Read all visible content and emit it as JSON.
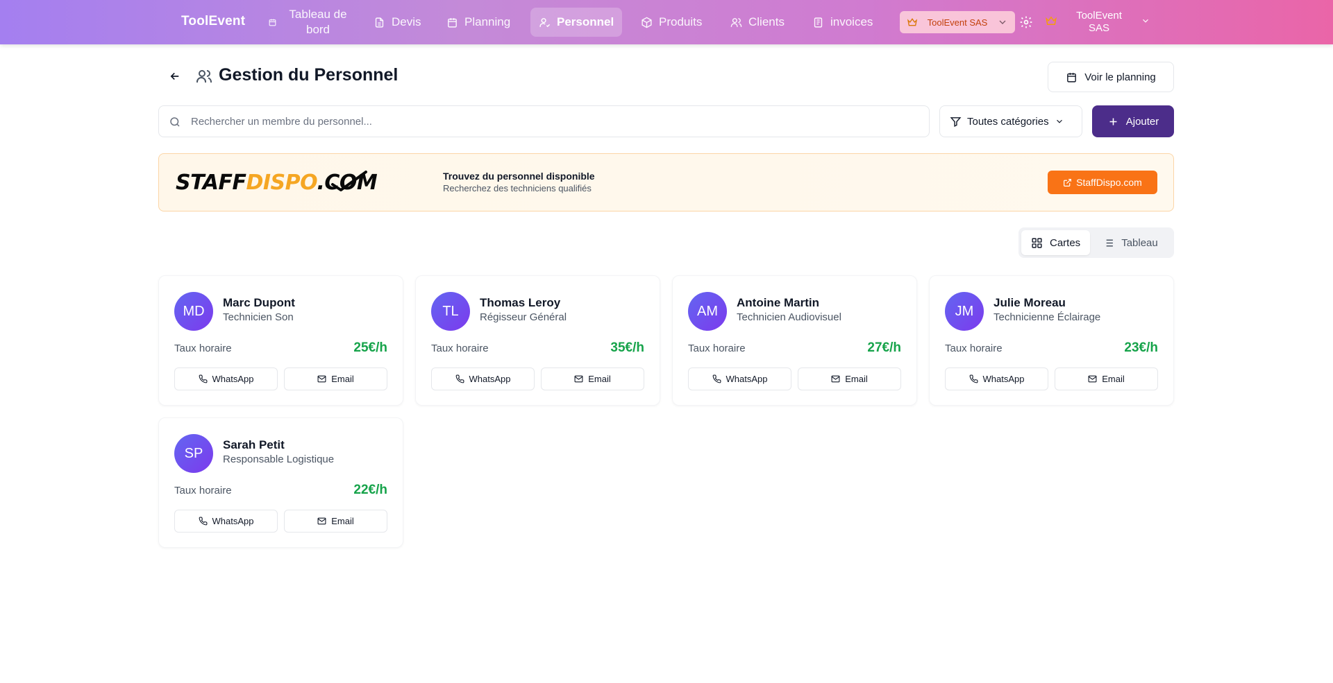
{
  "nav": {
    "brand": "ToolEvent",
    "items": [
      {
        "label": "Tableau de bord",
        "icon": "calendar-small-icon"
      },
      {
        "label": "Devis",
        "icon": "document-icon"
      },
      {
        "label": "Planning",
        "icon": "calendar-icon"
      },
      {
        "label": "Personnel",
        "icon": "user-check-icon",
        "active": true
      },
      {
        "label": "Produits",
        "icon": "package-icon"
      },
      {
        "label": "Clients",
        "icon": "users-icon"
      },
      {
        "label": "invoices",
        "icon": "receipt-icon"
      }
    ],
    "tenant": "ToolEvent SAS",
    "user": "ToolEvent SAS"
  },
  "header": {
    "title": "Gestion du Personnel",
    "planning_button": "Voir le planning"
  },
  "toolbar": {
    "search_placeholder": "Rechercher un membre du personnel...",
    "category": "Toutes catégories",
    "add_button": "Ajouter"
  },
  "banner": {
    "logo_part1": "STAFF",
    "logo_part2": "DISPO",
    "logo_part3": ".COM",
    "title": "Trouvez du personnel disponible",
    "subtitle": "Recherchez des techniciens qualifiés",
    "button": "StaffDispo.com"
  },
  "view_toggle": {
    "cards": "Cartes",
    "table": "Tableau",
    "active": "cards"
  },
  "rate_label": "Taux horaire",
  "actions": {
    "whatsapp": "WhatsApp",
    "email": "Email"
  },
  "staff": [
    {
      "initials": "MD",
      "name": "Marc Dupont",
      "role": "Technicien Son",
      "rate": "25€/h"
    },
    {
      "initials": "TL",
      "name": "Thomas Leroy",
      "role": "Régisseur Général",
      "rate": "35€/h"
    },
    {
      "initials": "AM",
      "name": "Antoine Martin",
      "role": "Technicien Audiovisuel",
      "rate": "27€/h"
    },
    {
      "initials": "JM",
      "name": "Julie Moreau",
      "role": "Technicienne Éclairage",
      "rate": "23€/h"
    },
    {
      "initials": "SP",
      "name": "Sarah Petit",
      "role": "Responsable Logistique",
      "rate": "22€/h"
    }
  ],
  "colors": {
    "accent": "#4c2d8a",
    "rate_green": "#16a34a",
    "banner_orange": "#f97316"
  }
}
